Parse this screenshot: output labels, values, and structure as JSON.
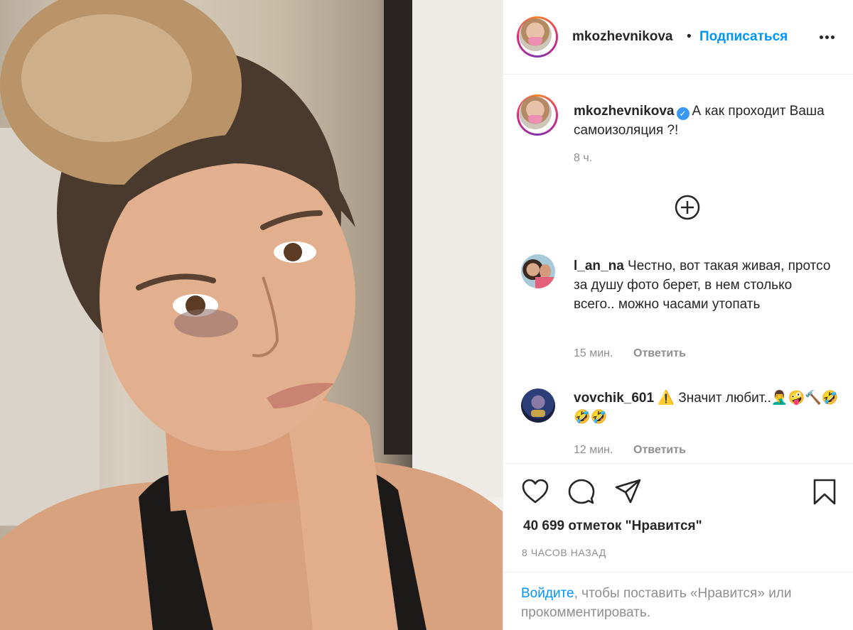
{
  "post": {
    "author": "mkozhevnikova",
    "separator": "•",
    "follow_label": "Подписаться",
    "more_icon": "more-horizontal-icon"
  },
  "caption": {
    "username": "mkozhevnikova",
    "verified_icon": "verified-badge-icon",
    "text": "А как проходит Ваша самоизоляция ?!",
    "time": "8 ч."
  },
  "load_more_icon": "plus-circle-icon",
  "comments": [
    {
      "username": "l_an_na",
      "text": "Честно, вот такая живая, протсо за душу фото берет, в нем столько всего.. можно часами утопать",
      "time": "15 мин.",
      "reply_label": "Ответить"
    },
    {
      "username": "vovchik_601",
      "text": "⚠️ Значит любит..🤦‍♂️🤪🔨🤣🤣🤣",
      "time": "12 мин.",
      "reply_label": "Ответить"
    }
  ],
  "action_icons": [
    "heart-icon",
    "comment-icon",
    "share-icon",
    "bookmark-icon"
  ],
  "likes_text": "40 699 отметок \"Нравится\"",
  "posted_ago": "8 ЧАСОВ НАЗАД",
  "login_prompt": {
    "link": "Войдите",
    "rest": ", чтобы поставить «Нравится» или прокомментировать."
  },
  "colors": {
    "link_blue": "#0095f6",
    "text": "#262626",
    "secondary": "#8e8e8e",
    "verified": "#3897f0"
  }
}
